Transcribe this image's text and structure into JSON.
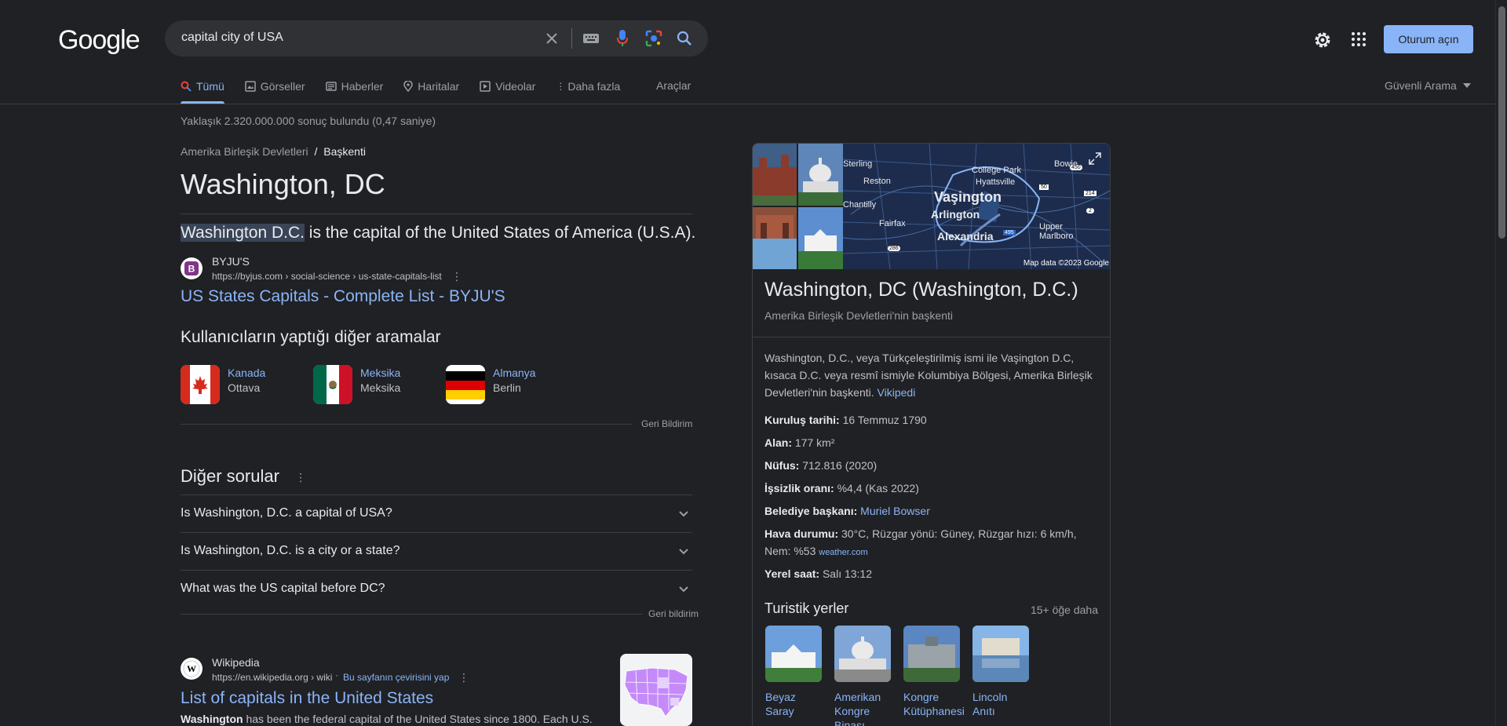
{
  "logo": "Google",
  "search": {
    "query": "capital city of USA"
  },
  "header": {
    "signin": "Oturum açın"
  },
  "tabs": [
    "Tümü",
    "Görseller",
    "Haberler",
    "Haritalar",
    "Videolar",
    "Daha fazla"
  ],
  "tools": "Araçlar",
  "safe_search": "Güvenli Arama",
  "result_stats": "Yaklaşık 2.320.000.000 sonuç bulundu (0,47 saniye)",
  "featured": {
    "breadcrumb_parent": "Amerika Birleşik Devletleri",
    "breadcrumb_sep": "/",
    "breadcrumb_current": "Başkenti",
    "title": "Washington, DC",
    "answer_highlight": "Washington D.C.",
    "answer_rest": " is the capital of the United States of America (U.S.A).",
    "source_name": "BYJU'S",
    "source_url": "https://byjus.com › social-science › us-state-capitals-list",
    "source_link": "US States Capitals - Complete List - BYJU'S"
  },
  "others": {
    "heading": "Kullanıcıların yaptığı diğer aramalar",
    "items": [
      {
        "name": "Kanada",
        "capital": "Ottava"
      },
      {
        "name": "Meksika",
        "capital": "Meksika"
      },
      {
        "name": "Almanya",
        "capital": "Berlin"
      }
    ],
    "feedback": "Geri Bildirim"
  },
  "paa": {
    "heading": "Diğer sorular",
    "questions": [
      "Is Washington, D.C. a capital of USA?",
      "Is Washington, D.C. is a city or a state?",
      "What was the US capital before DC?"
    ],
    "feedback": "Geri bildirim"
  },
  "wiki": {
    "source_name": "Wikipedia",
    "source_url": "https://en.wikipedia.org › wiki",
    "translate": "Bu sayfanın çevirisini yap",
    "link": "List of capitals in the United States",
    "snippet_bold": "Washington",
    "snippet_rest": " has been the federal capital of the United States since 1800. Each U.S."
  },
  "kp": {
    "map_labels": [
      "Sterling",
      "Reston",
      "Chantilly",
      "Fairfax",
      "College Park",
      "Hyattsville",
      "Bowie",
      "Vaşington",
      "Arlington",
      "Alexandria",
      "Upper Marlboro"
    ],
    "map_shields": [
      "450",
      "50",
      "214",
      "2",
      "495",
      "286"
    ],
    "map_credit": "Map data ©2023 Google",
    "title": "Washington, DC (Washington, D.C.)",
    "subtitle": "Amerika Birleşik Devletleri'nin başkenti",
    "description": "Washington, D.C., veya Türkçeleştirilmiş ismi ile Vaşington D.C, kısaca D.C. veya resmî ismiyle Kolumbiya Bölgesi, Amerika Birleşik Devletleri'nin başkenti.",
    "description_link": "Vikipedi",
    "facts": [
      {
        "label": "Kuruluş tarihi:",
        "value": "16 Temmuz 1790"
      },
      {
        "label": "Alan:",
        "value": "177 km²"
      },
      {
        "label": "Nüfus:",
        "value": "712.816 (2020)"
      },
      {
        "label": "İşsizlik oranı:",
        "value": "%4,4 (Kas 2022)"
      },
      {
        "label": "Belediye başkanı:",
        "value": "Muriel Bowser"
      },
      {
        "label": "Hava durumu:",
        "value": "30°C, Rüzgar yönü: Güney, Rüzgar hızı: 6 km/h, Nem: %53",
        "link": "weather.com"
      },
      {
        "label": "Yerel saat:",
        "value": "Salı 13:12"
      }
    ],
    "tour_heading": "Turistik yerler",
    "tour_more": "15+ öğe daha",
    "tour": [
      "Beyaz Saray",
      "Amerikan Kongre Binası",
      "Kongre Kütüphanesi",
      "Lincoln Anıtı"
    ]
  }
}
